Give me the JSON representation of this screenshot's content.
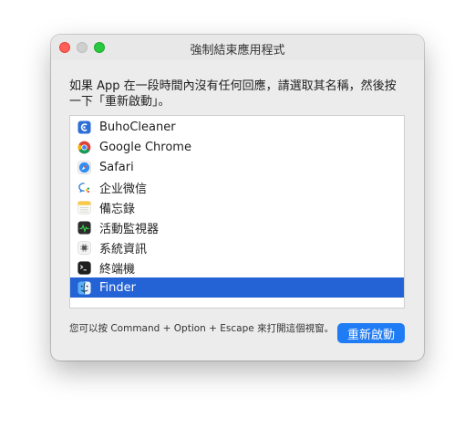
{
  "window": {
    "title": "強制結束應用程式"
  },
  "prompt": {
    "line1": "如果 App 在一段時間內沒有任何回應，請選取其名稱，然後按",
    "line2": "一下「重新啟動」。"
  },
  "apps": [
    {
      "name": "BuhoCleaner",
      "icon": "buhocleaner-icon"
    },
    {
      "name": "Google Chrome",
      "icon": "chrome-icon"
    },
    {
      "name": "Safari",
      "icon": "safari-icon"
    },
    {
      "name": "企业微信",
      "icon": "wecom-icon"
    },
    {
      "name": "備忘錄",
      "icon": "notes-icon"
    },
    {
      "name": "活動監視器",
      "icon": "activity-monitor-icon"
    },
    {
      "name": "系統資訊",
      "icon": "system-information-icon"
    },
    {
      "name": "終端機",
      "icon": "terminal-icon"
    },
    {
      "name": "Finder",
      "icon": "finder-icon"
    }
  ],
  "selected_app": "Finder",
  "footer": {
    "hint": "您可以按 Command + Option + Escape 來打開這個視窗。",
    "relaunch_label": "重新啟動"
  },
  "colors": {
    "selection": "#2463d6",
    "button": "#1f7cf4"
  }
}
